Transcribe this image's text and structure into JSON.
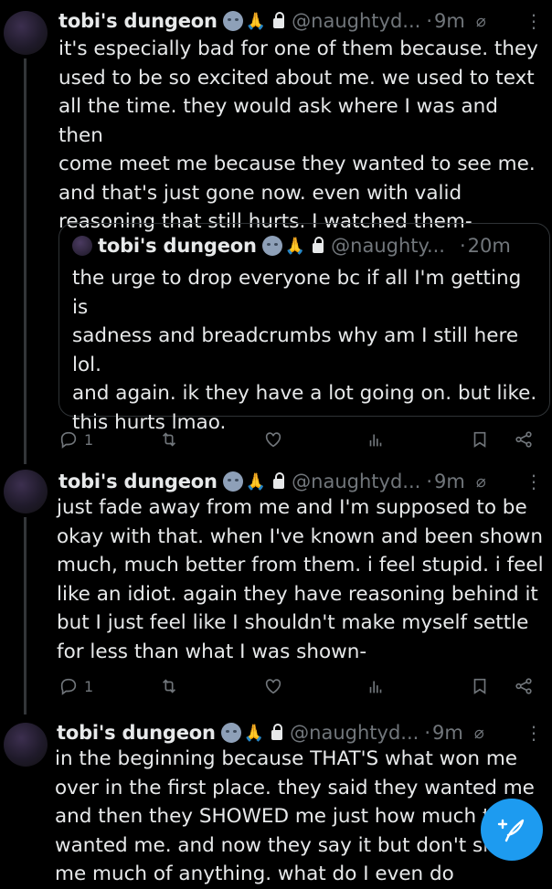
{
  "tweets": [
    {
      "name": "tobi's dungeon",
      "handle": "@naughtyd...",
      "dot": "·",
      "time": "9m",
      "more": "⋮",
      "text": "it's especially bad for one of them because. they\nused to be so excited about me. we used to text\nall the time. they would ask where I was and then\ncome meet me because they wanted to see me.\nand that's just gone now. even with valid\nreasoning that still hurts. I watched them-",
      "quote": {
        "name": "tobi's dungeon",
        "handle": "@naughty...",
        "dot": "·",
        "time": "20m",
        "text": "the urge to drop everyone bc if all I'm getting is\nsadness and breadcrumbs why am I still here\nlol.\nand again. ik they have a lot going on. but like.\nthis hurts lmao."
      },
      "reply_count": "1"
    },
    {
      "name": "tobi's dungeon",
      "handle": "@naughtyd...",
      "dot": "·",
      "time": "9m",
      "more": "⋮",
      "text": "just fade away from me and I'm supposed to be\nokay with that. when I've known and been shown\nmuch, much better from them. i feel stupid. i feel\nlike an idiot. again they have reasoning behind it\nbut I just feel like I shouldn't make myself settle\nfor less than what I was shown-",
      "reply_count": "1"
    },
    {
      "name": "tobi's dungeon",
      "handle": "@naughtyd...",
      "dot": "·",
      "time": "9m",
      "more": "⋮",
      "text": "in the beginning because THAT'S what won me\nover in the first place. they said they wanted me\nand then they SHOWED me just how much they\nwanted me. and now they say it but don't show\nme much of anything. what do I even do"
    }
  ],
  "colors": {
    "background": "#000000",
    "text": "#e7e9ea",
    "muted": "#71767b",
    "accent": "#1d9bf0"
  },
  "icons": [
    "reply-icon",
    "retweet-icon",
    "like-icon",
    "views-icon",
    "bookmark-icon",
    "share-icon",
    "grok-icon",
    "lock-icon",
    "compose-icon"
  ]
}
